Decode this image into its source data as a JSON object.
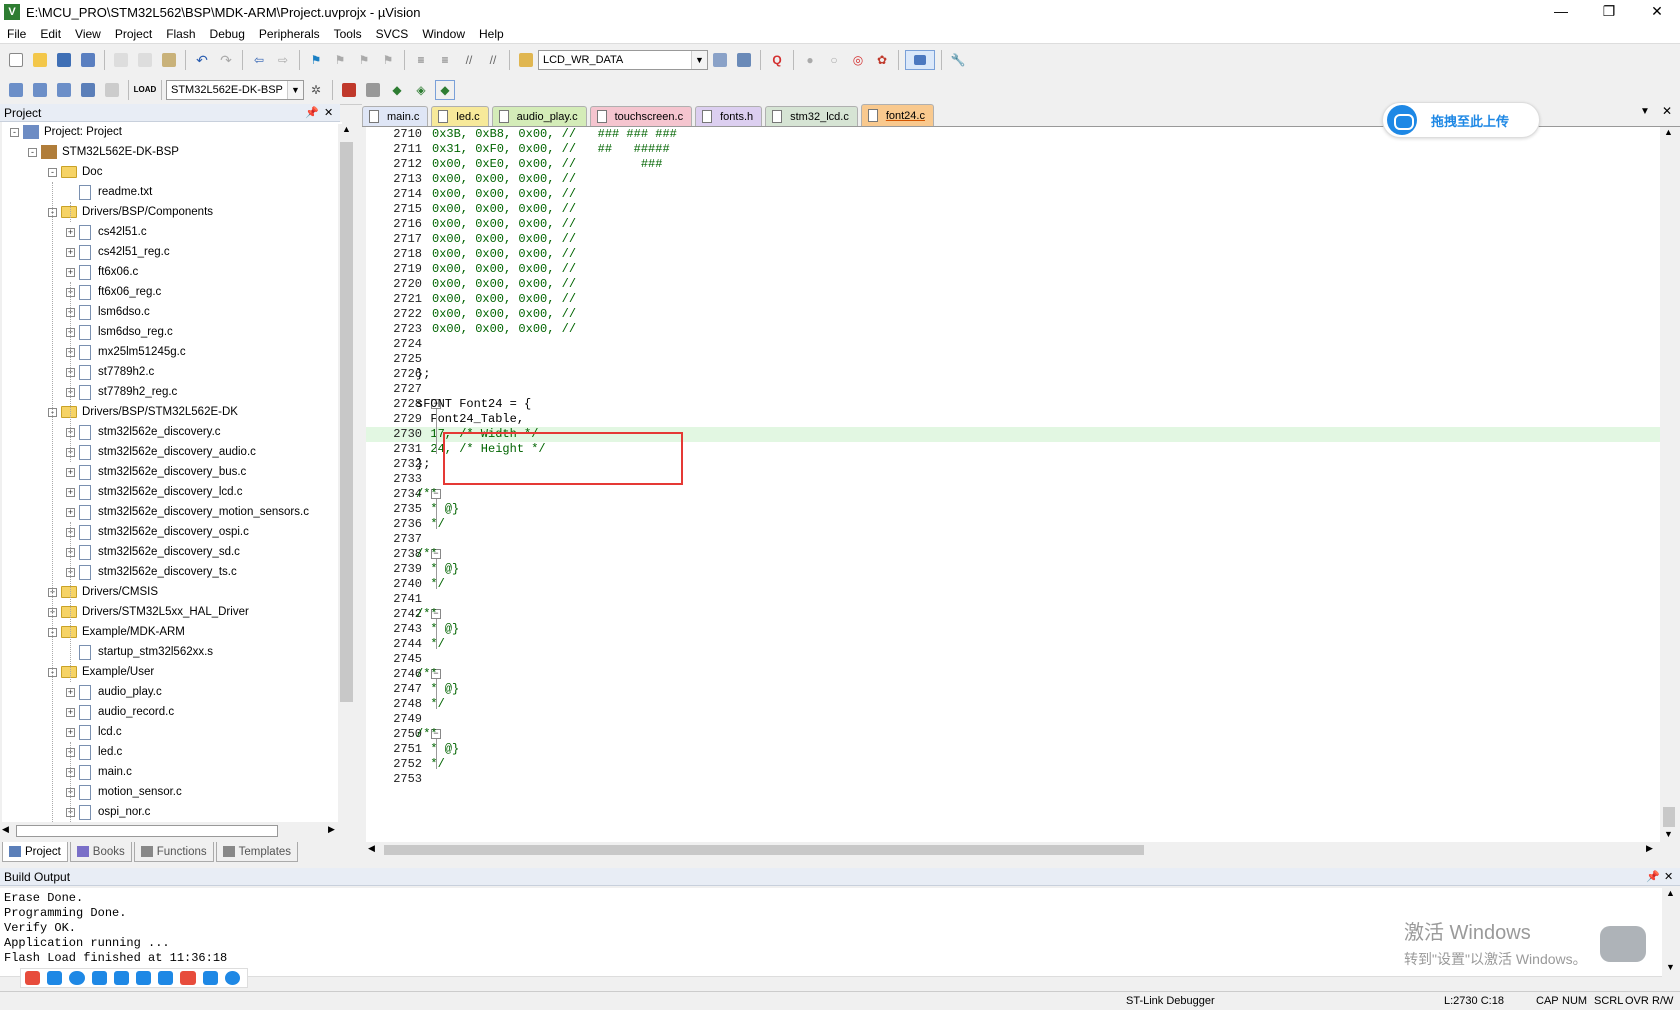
{
  "window": {
    "title": "E:\\MCU_PRO\\STM32L562\\BSP\\MDK-ARM\\Project.uvprojx - µVision",
    "app_icon": "V"
  },
  "menu": [
    "File",
    "Edit",
    "View",
    "Project",
    "Flash",
    "Debug",
    "Peripherals",
    "Tools",
    "SVCS",
    "Window",
    "Help"
  ],
  "toolbar": {
    "find_combo": "LCD_WR_DATA",
    "target_combo": "STM32L562E-DK-BSP"
  },
  "project_panel": {
    "title": "Project",
    "tree": [
      {
        "label": "Project: Project",
        "level": 0,
        "type": "project",
        "exp": "-"
      },
      {
        "label": "STM32L562E-DK-BSP",
        "level": 1,
        "type": "target",
        "exp": "-"
      },
      {
        "label": "Doc",
        "level": 2,
        "type": "folder",
        "exp": "-"
      },
      {
        "label": "readme.txt",
        "level": 3,
        "type": "file",
        "exp": ""
      },
      {
        "label": "Drivers/BSP/Components",
        "level": 2,
        "type": "folder",
        "exp": "-"
      },
      {
        "label": "cs42l51.c",
        "level": 3,
        "type": "file",
        "exp": "+"
      },
      {
        "label": "cs42l51_reg.c",
        "level": 3,
        "type": "file",
        "exp": "+"
      },
      {
        "label": "ft6x06.c",
        "level": 3,
        "type": "file",
        "exp": "+"
      },
      {
        "label": "ft6x06_reg.c",
        "level": 3,
        "type": "file",
        "exp": "+"
      },
      {
        "label": "lsm6dso.c",
        "level": 3,
        "type": "file",
        "exp": "+"
      },
      {
        "label": "lsm6dso_reg.c",
        "level": 3,
        "type": "file",
        "exp": "+"
      },
      {
        "label": "mx25lm51245g.c",
        "level": 3,
        "type": "file",
        "exp": "+"
      },
      {
        "label": "st7789h2.c",
        "level": 3,
        "type": "file",
        "exp": "+"
      },
      {
        "label": "st7789h2_reg.c",
        "level": 3,
        "type": "file",
        "exp": "+"
      },
      {
        "label": "Drivers/BSP/STM32L562E-DK",
        "level": 2,
        "type": "folder",
        "exp": "-"
      },
      {
        "label": "stm32l562e_discovery.c",
        "level": 3,
        "type": "file",
        "exp": "+"
      },
      {
        "label": "stm32l562e_discovery_audio.c",
        "level": 3,
        "type": "file",
        "exp": "+"
      },
      {
        "label": "stm32l562e_discovery_bus.c",
        "level": 3,
        "type": "file",
        "exp": "+"
      },
      {
        "label": "stm32l562e_discovery_lcd.c",
        "level": 3,
        "type": "file",
        "exp": "+"
      },
      {
        "label": "stm32l562e_discovery_motion_sensors.c",
        "level": 3,
        "type": "file",
        "exp": "+"
      },
      {
        "label": "stm32l562e_discovery_ospi.c",
        "level": 3,
        "type": "file",
        "exp": "+"
      },
      {
        "label": "stm32l562e_discovery_sd.c",
        "level": 3,
        "type": "file",
        "exp": "+"
      },
      {
        "label": "stm32l562e_discovery_ts.c",
        "level": 3,
        "type": "file",
        "exp": "+"
      },
      {
        "label": "Drivers/CMSIS",
        "level": 2,
        "type": "folder",
        "exp": "+"
      },
      {
        "label": "Drivers/STM32L5xx_HAL_Driver",
        "level": 2,
        "type": "folder",
        "exp": "+"
      },
      {
        "label": "Example/MDK-ARM",
        "level": 2,
        "type": "folder",
        "exp": "-"
      },
      {
        "label": "startup_stm32l562xx.s",
        "level": 3,
        "type": "file",
        "exp": ""
      },
      {
        "label": "Example/User",
        "level": 2,
        "type": "folder",
        "exp": "-"
      },
      {
        "label": "audio_play.c",
        "level": 3,
        "type": "file",
        "exp": "+"
      },
      {
        "label": "audio_record.c",
        "level": 3,
        "type": "file",
        "exp": "+"
      },
      {
        "label": "lcd.c",
        "level": 3,
        "type": "file",
        "exp": "+"
      },
      {
        "label": "led.c",
        "level": 3,
        "type": "file",
        "exp": "+"
      },
      {
        "label": "main.c",
        "level": 3,
        "type": "file",
        "exp": "+"
      },
      {
        "label": "motion_sensor.c",
        "level": 3,
        "type": "file",
        "exp": "+"
      },
      {
        "label": "ospi_nor.c",
        "level": 3,
        "type": "file",
        "exp": "+"
      }
    ],
    "bottom_tabs": [
      "Project",
      "Books",
      "Functions",
      "Templates"
    ]
  },
  "editor_tabs": [
    {
      "label": "main.c",
      "color": "#dfe6f6"
    },
    {
      "label": "led.c",
      "color": "#f7e99a"
    },
    {
      "label": "audio_play.c",
      "color": "#d4ecb8"
    },
    {
      "label": "touchscreen.c",
      "color": "#f5c5cf"
    },
    {
      "label": "fonts.h",
      "color": "#dccff0"
    },
    {
      "label": "stm32_lcd.c",
      "color": "#d6e4d4"
    },
    {
      "label": "font24.c",
      "color": "#f9c98e",
      "active": true
    }
  ],
  "upload_button": "拖拽至此上传",
  "code_lines": [
    {
      "n": "2710",
      "t": "0x3B, 0xB8, 0x00, //   ### ### ###",
      "c": "g"
    },
    {
      "n": "2711",
      "t": "0x31, 0xF0, 0x00, //   ##   #####",
      "c": "g"
    },
    {
      "n": "2712",
      "t": "0x00, 0xE0, 0x00, //         ###",
      "c": "g"
    },
    {
      "n": "2713",
      "t": "0x00, 0x00, 0x00, //",
      "c": "g"
    },
    {
      "n": "2714",
      "t": "0x00, 0x00, 0x00, //",
      "c": "g"
    },
    {
      "n": "2715",
      "t": "0x00, 0x00, 0x00, //",
      "c": "g"
    },
    {
      "n": "2716",
      "t": "0x00, 0x00, 0x00, //",
      "c": "g"
    },
    {
      "n": "2717",
      "t": "0x00, 0x00, 0x00, //",
      "c": "g"
    },
    {
      "n": "2718",
      "t": "0x00, 0x00, 0x00, //",
      "c": "g"
    },
    {
      "n": "2719",
      "t": "0x00, 0x00, 0x00, //",
      "c": "g"
    },
    {
      "n": "2720",
      "t": "0x00, 0x00, 0x00, //",
      "c": "g"
    },
    {
      "n": "2721",
      "t": "0x00, 0x00, 0x00, //",
      "c": "g"
    },
    {
      "n": "2722",
      "t": "0x00, 0x00, 0x00, //",
      "c": "g"
    },
    {
      "n": "2723",
      "t": "0x00, 0x00, 0x00, //",
      "c": "g"
    },
    {
      "n": "2724",
      "t": "",
      "c": "k"
    },
    {
      "n": "2725",
      "t": "",
      "c": "k"
    },
    {
      "n": "2726",
      "t": "};",
      "c": "k"
    },
    {
      "n": "2727",
      "t": "",
      "c": "k"
    },
    {
      "n": "2728",
      "t": "sFONT Font24 = {",
      "c": "k",
      "fold": true
    },
    {
      "n": "2729",
      "t": "  Font24_Table,",
      "c": "k"
    },
    {
      "n": "2730",
      "t": "  17, /* Width */",
      "c": "g",
      "hl": true
    },
    {
      "n": "2731",
      "t": "  24, /* Height */",
      "c": "g"
    },
    {
      "n": "2732",
      "t": "};",
      "c": "k"
    },
    {
      "n": "2733",
      "t": "",
      "c": "k"
    },
    {
      "n": "2734",
      "t": "/**",
      "c": "g",
      "fold": true
    },
    {
      "n": "2735",
      "t": "  * @}",
      "c": "g"
    },
    {
      "n": "2736",
      "t": "  */",
      "c": "g"
    },
    {
      "n": "2737",
      "t": "",
      "c": "k"
    },
    {
      "n": "2738",
      "t": "/**",
      "c": "g",
      "fold": true
    },
    {
      "n": "2739",
      "t": "  * @}",
      "c": "g"
    },
    {
      "n": "2740",
      "t": "  */",
      "c": "g"
    },
    {
      "n": "2741",
      "t": "",
      "c": "k"
    },
    {
      "n": "2742",
      "t": "/**",
      "c": "g",
      "fold": true
    },
    {
      "n": "2743",
      "t": "  * @}",
      "c": "g"
    },
    {
      "n": "2744",
      "t": "  */",
      "c": "g"
    },
    {
      "n": "2745",
      "t": "",
      "c": "k"
    },
    {
      "n": "2746",
      "t": "/**",
      "c": "g",
      "fold": true
    },
    {
      "n": "2747",
      "t": "  * @}",
      "c": "g"
    },
    {
      "n": "2748",
      "t": "  */",
      "c": "g"
    },
    {
      "n": "2749",
      "t": "",
      "c": "k"
    },
    {
      "n": "2750",
      "t": "/**",
      "c": "g",
      "fold": true
    },
    {
      "n": "2751",
      "t": "  * @}",
      "c": "g"
    },
    {
      "n": "2752",
      "t": "  */",
      "c": "g"
    },
    {
      "n": "2753",
      "t": "",
      "c": "k"
    }
  ],
  "build_output": {
    "title": "Build Output",
    "lines": [
      "Erase Done.",
      "Programming Done.",
      "Verify OK.",
      "Application running ...",
      "Flash Load finished at 11:36:18"
    ]
  },
  "watermark": {
    "line1": "激活 Windows",
    "line2": "转到\"设置\"以激活 Windows。"
  },
  "status": {
    "debugger": "ST-Link Debugger",
    "position": "L:2730 C:18",
    "cap": "CAP",
    "num": "NUM",
    "scrl": "SCRL",
    "ovr": "OVR",
    "rw": "R/W"
  }
}
